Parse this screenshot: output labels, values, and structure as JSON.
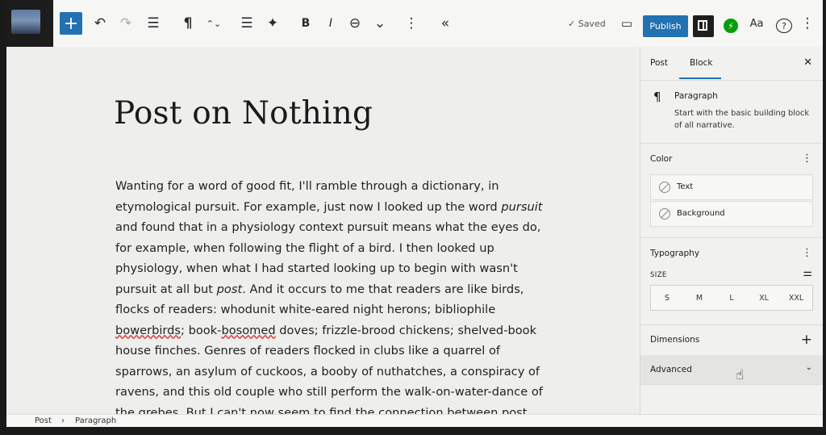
{
  "toolbar": {
    "add_icon": "+",
    "undo_icon": "↶",
    "redo_icon": "↷",
    "list_view_icon": "☰",
    "paragraph_icon": "¶",
    "move_icon": "⌃⌄",
    "align_icon": "☰",
    "ai_icon": "✦",
    "bold_label": "B",
    "italic_label": "I",
    "link_icon": "⊖",
    "more_rich_icon": "⌄",
    "options_icon": "⋮",
    "collapse_icon": "«",
    "saved_label": "✓ Saved",
    "preview_icon": "▭",
    "publish_label": "Publish",
    "jetpack_icon": "⚡",
    "styles_label": "Aa",
    "help_icon": "?",
    "more_icon": "⋮"
  },
  "post": {
    "title": "Post on Nothing",
    "p1": "Wanting for a word of good fit, I'll ramble through a dictionary, in etymological pursuit. For example, just now I looked up the word ",
    "p1_em": "pursuit",
    "p2": " and found that in a physiology context pursuit means what the eyes do, for example, when following the flight of a bird. I then looked up physiology, when what I had started looking up to begin with wasn't pursuit at all but ",
    "p2_em": "post",
    "p3": ". And it occurs to me that readers are like birds, flocks of readers: whodunit white-eared night herons; bibliophile ",
    "p3_sp1": "bowerbirds",
    "p4": "; book-",
    "p4_sp2": "bosomed",
    "p5": " doves; frizzle-brood chickens; shelved-book house finches. Genres of readers flocked in clubs like a quarrel of sparrows, an asylum of cuckoos, a booby of nuthatches, a conspiracy of ravens, and this old couple who still perform the walk-on-water-dance of the grebes. But I can't now seem to find the connection between post and pursuit, but perhaps it's obvious"
  },
  "sidebar": {
    "tab_post": "Post",
    "tab_block": "Block",
    "close_icon": "✕",
    "block_icon": "¶",
    "block_name": "Paragraph",
    "block_desc": "Start with the basic building block of all narrative.",
    "color_title": "Color",
    "color_text": "Text",
    "color_background": "Background",
    "typo_title": "Typography",
    "size_label": "SIZE",
    "sizes": [
      "S",
      "M",
      "L",
      "XL",
      "XXL"
    ],
    "dimensions_title": "Dimensions",
    "plus_icon": "+",
    "advanced_title": "Advanced",
    "chevron_icon": "⌄",
    "kebab_icon": "⋮",
    "sliders_icon": "⚌",
    "cursor_icon": "☝"
  },
  "breadcrumb": {
    "post": "Post",
    "sep": "›",
    "paragraph": "Paragraph"
  }
}
